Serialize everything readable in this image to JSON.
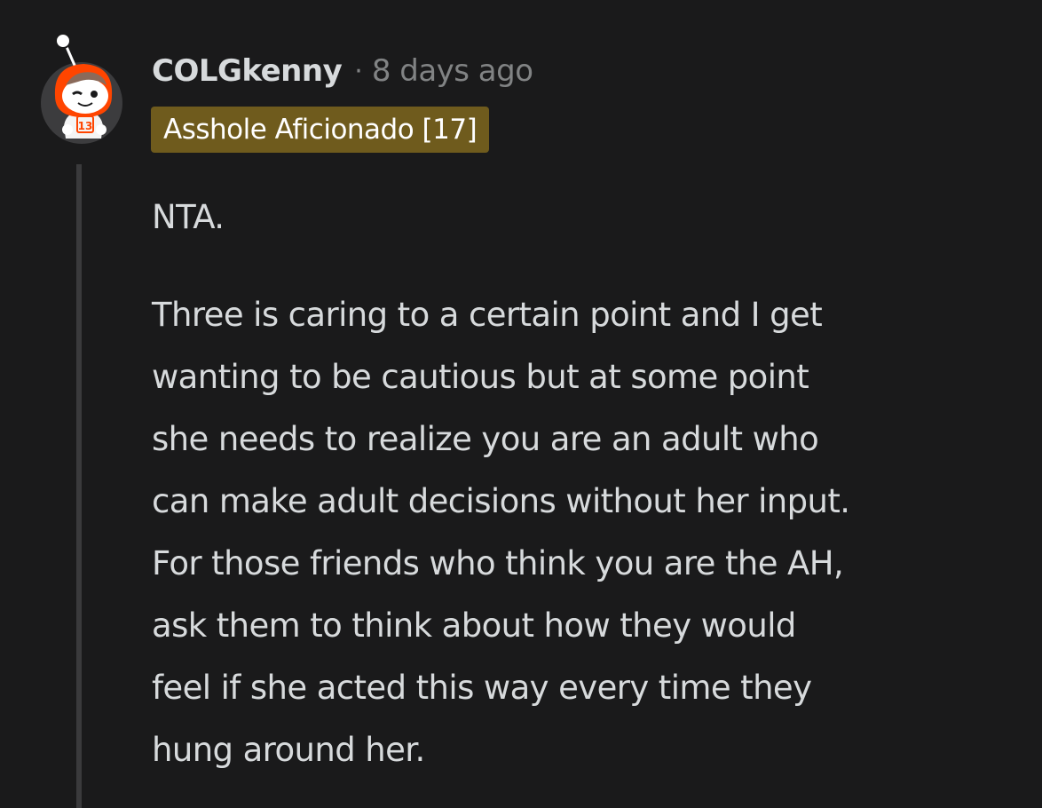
{
  "comment": {
    "username": "COLGkenny",
    "separator": "·",
    "timestamp": "8 days ago",
    "flair": {
      "text": "Asshole Aficionado [17]",
      "background_color": "#6f5b1d"
    },
    "avatar": {
      "icon": "snoo-avatar-icon"
    },
    "body": {
      "first_paragraph": "NTA.",
      "lines": [
        "Three is caring to a certain point and I get",
        "wanting to be cautious but at some point",
        "she needs to realize you are an adult who",
        "can make adult decisions without her input.",
        "For those friends who think you are the AH,",
        "ask them to think about how they would",
        "feel if she acted this way every time they",
        "hung around her."
      ]
    }
  },
  "colors": {
    "background": "#1a1a1b",
    "text": "#d7dadc",
    "meta": "#818384",
    "thread_line": "#3a3a3c",
    "avatar_accent": "#ff4500"
  }
}
